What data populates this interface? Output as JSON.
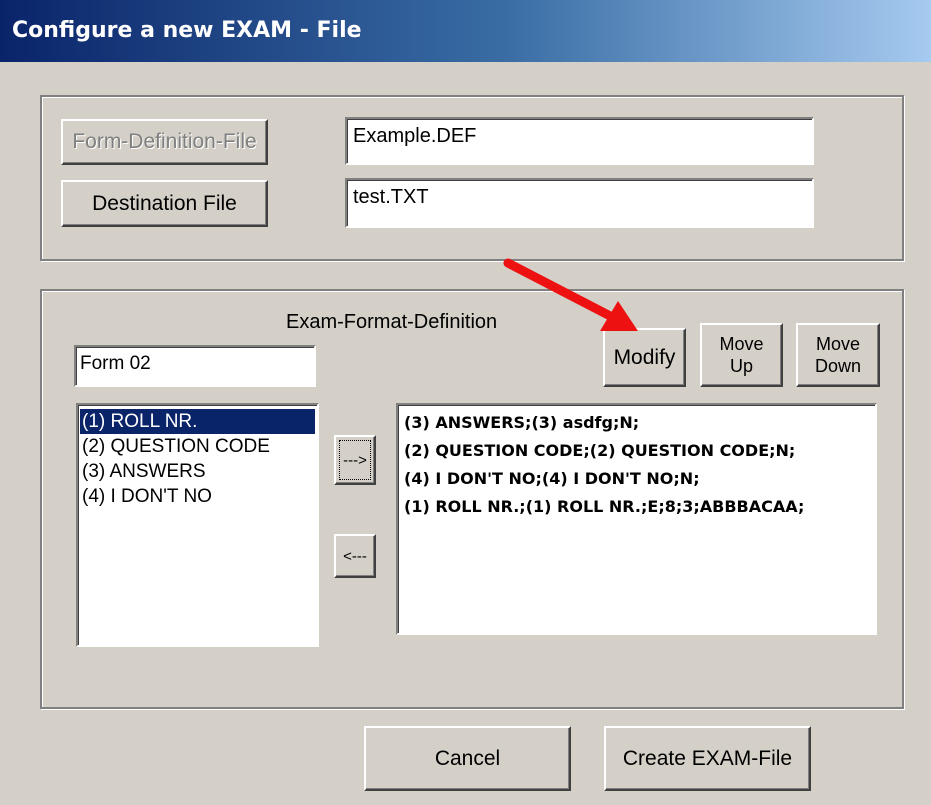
{
  "window": {
    "title": "Configure a new EXAM - File"
  },
  "files": {
    "form_def_button": "Form-Definition-File",
    "form_def_value": "Example.DEF",
    "dest_button": "Destination File",
    "dest_value": "test.TXT"
  },
  "format": {
    "group_label": "Exam-Format-Definition",
    "form_name": "Form 02",
    "modify_label": "Modify",
    "move_up_line1": "Move",
    "move_up_line2": "Up",
    "move_down_line1": "Move",
    "move_down_line2": "Down",
    "add_label": "--->",
    "remove_label": "<---",
    "available_items": [
      "(1) ROLL NR.",
      "(2) QUESTION CODE",
      "(3) ANSWERS",
      "(4) I DON'T NO"
    ],
    "selected_items": [
      "(3) ANSWERS;(3) asdfg;N;",
      "(2) QUESTION CODE;(2) QUESTION CODE;N;",
      "(4) I DON'T NO;(4) I DON'T NO;N;",
      "(1) ROLL NR.;(1) ROLL NR.;E;8;3;ABBBACAA;"
    ]
  },
  "footer": {
    "cancel_label": "Cancel",
    "create_label": "Create EXAM-File"
  },
  "annotation": {
    "arrow_color": "#ee1111",
    "arrow_icon": "red-arrow-icon"
  }
}
